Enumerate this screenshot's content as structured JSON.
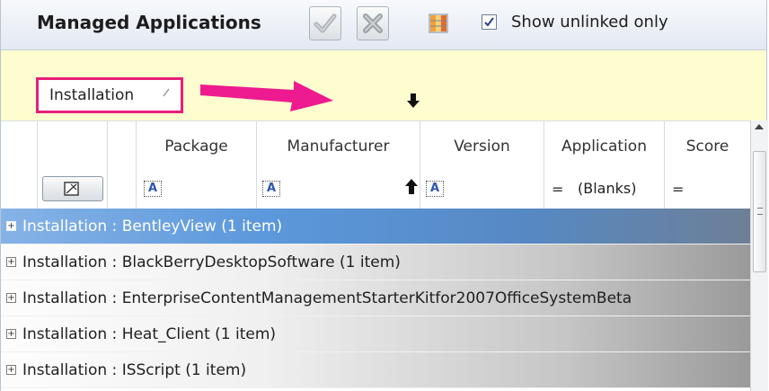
{
  "header": {
    "title": "Managed Applications",
    "checkbox_label": "Show unlinked only",
    "checkbox_checked": true
  },
  "groupby": {
    "chip_label": "Installation"
  },
  "columns": [
    "Package",
    "Manufacturer",
    "Version",
    "Application",
    "Score"
  ],
  "filter": {
    "text_marker": "A",
    "equals": "=",
    "application_value": "(Blanks)"
  },
  "groups": [
    {
      "expander": "+",
      "text": "Installation : BentleyView (1 item)",
      "selected": true
    },
    {
      "expander": "+",
      "text": "Installation : BlackBerryDesktopSoftware (1 item)",
      "selected": false
    },
    {
      "expander": "+",
      "text": "Installation : EnterpriseContentManagementStarterKitfor2007OfficeSystemBeta",
      "selected": false
    },
    {
      "expander": "+",
      "text": "Installation : Heat_Client (1 item)",
      "selected": false
    },
    {
      "expander": "+",
      "text": "Installation : ISScript (1 item)",
      "selected": false
    }
  ],
  "colors": {
    "chip_border": "#e91e79",
    "drag_arrow": "#ee1a8f",
    "group_bar_bg": "#fdfdcf",
    "selected_row": "#5c98dc"
  },
  "icons": [
    "approve-check-icon",
    "reject-x-icon",
    "column-chooser-icon",
    "drag-arrow-icon",
    "drop-indicator-arrow-icon",
    "clear-filter-icon",
    "sort-asc-icon"
  ]
}
